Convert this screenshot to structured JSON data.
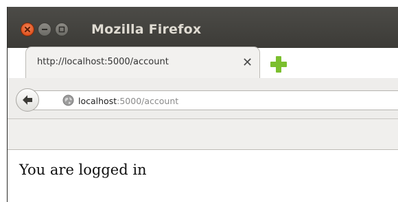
{
  "window": {
    "title": "Mozilla Firefox"
  },
  "tab": {
    "title": "http://localhost:5000/account",
    "close_glyph": "✕"
  },
  "address_bar": {
    "host": "localhost",
    "rest": ":5000/account"
  },
  "page": {
    "message": "You are logged in"
  },
  "icons": {
    "window_close": "close-icon",
    "window_minimize": "minimize-icon",
    "window_maximize": "maximize-icon",
    "new_tab": "plus-icon",
    "back": "back-arrow-icon",
    "site_identity": "globe-icon"
  },
  "colors": {
    "titlebar": "#3c3b37",
    "title_text": "#dfdbd2",
    "close_button": "#e0521f",
    "new_tab_plus": "#7bbf2e"
  }
}
